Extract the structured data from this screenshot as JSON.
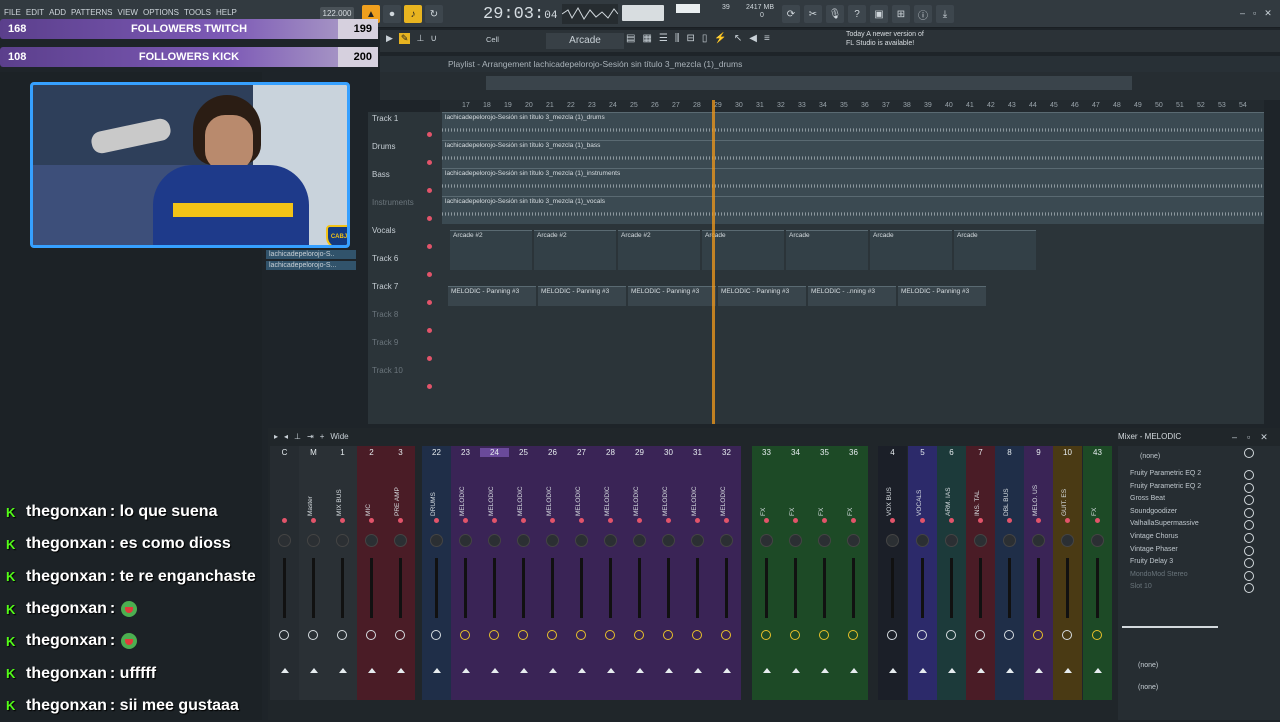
{
  "menu": [
    "FILE",
    "EDIT",
    "ADD",
    "PATTERNS",
    "VIEW",
    "OPTIONS",
    "TOOLS",
    "HELP"
  ],
  "transport": {
    "tempo": "122.000",
    "time_main": "29:03",
    "time_sub": "04",
    "cpu": "39",
    "ram": "2417 MB",
    "voices": "0"
  },
  "toolbar": {
    "snap": "Cell",
    "pattern": "Arcade"
  },
  "hint": {
    "line1": "Today  A newer version of",
    "line2": "FL Studio is available!"
  },
  "followers": [
    {
      "left": "168",
      "label": "FOLLOWERS TWITCH",
      "right": "199"
    },
    {
      "left": "108",
      "label": "FOLLOWERS KICK",
      "right": "200"
    }
  ],
  "browser": {
    "items": [
      "lachicadepelorojo-S..",
      "lachicadepelorojo-S..."
    ]
  },
  "playlist": {
    "title": "Playlist - Arrangement  lachicadepelorojo-Sesión sin título 3_mezcla (1)_drums",
    "ruler": [
      "17",
      "18",
      "19",
      "20",
      "21",
      "22",
      "23",
      "24",
      "25",
      "26",
      "27",
      "28",
      "29",
      "30",
      "31",
      "32",
      "33",
      "34",
      "35",
      "36",
      "37",
      "38",
      "39",
      "40",
      "41",
      "42",
      "43",
      "44",
      "45",
      "46",
      "47",
      "48",
      "49",
      "50",
      "51",
      "52",
      "53",
      "54"
    ],
    "tracks": [
      {
        "name": "Track 1",
        "clip": "lachicadepelorojo-Sesión sin título 3_mezcla (1)_drums",
        "dim": false
      },
      {
        "name": "Drums",
        "clip": "lachicadepelorojo-Sesión sin título 3_mezcla (1)_bass",
        "dim": false
      },
      {
        "name": "Bass",
        "clip": "lachicadepelorojo-Sesión sin título 3_mezcla (1)_instruments",
        "dim": false
      },
      {
        "name": "Instruments",
        "clip": "lachicadepelorojo-Sesión sin título 3_mezcla (1)_vocals",
        "dim": true
      },
      {
        "name": "Vocals",
        "clip": "Arcade #2",
        "dim": false
      },
      {
        "name": "Track 6",
        "clip": "",
        "dim": false
      },
      {
        "name": "Track 7",
        "clip": "MELODIC - Panning #3",
        "dim": false
      },
      {
        "name": "Track 8",
        "clip": "",
        "dim": true
      },
      {
        "name": "Track 9",
        "clip": "",
        "dim": true
      },
      {
        "name": "Track 10",
        "clip": "",
        "dim": true
      }
    ],
    "arcade_clips": [
      "Arcade #2",
      "Arcade #2",
      "Arcade #2",
      "Arcade",
      "Arcade",
      "Arcade",
      "Arcade"
    ],
    "panning_clips": [
      "MELODIC - Panning #3",
      "MELODIC - Panning #3",
      "MELODIC - Panning #3",
      "MELODIC - Panning #3",
      "MELODIC - ..nning #3",
      "MELODIC - Panning #3"
    ]
  },
  "mixer": {
    "title": "Mixer - MELODIC",
    "mode": "Wide",
    "strips": [
      {
        "n": "C",
        "lbl": "",
        "color": "#262c31"
      },
      {
        "n": "M",
        "lbl": "Master",
        "color": "#2a3035"
      },
      {
        "n": "1",
        "lbl": "MIX BUS",
        "color": "#2a3035"
      },
      {
        "n": "2",
        "lbl": "MIC",
        "color": "#4a1c26"
      },
      {
        "n": "3",
        "lbl": "PRE AMP",
        "color": "#4a1c26"
      },
      {
        "n": "22",
        "lbl": "DRUMS",
        "color": "#1f2e48"
      },
      {
        "n": "23",
        "lbl": "MELODIC",
        "color": "#3a2456"
      },
      {
        "n": "24",
        "lbl": "MELODIC",
        "color": "#3a2456"
      },
      {
        "n": "25",
        "lbl": "MELODIC",
        "color": "#3a2456"
      },
      {
        "n": "26",
        "lbl": "MELODIC",
        "color": "#3a2456"
      },
      {
        "n": "27",
        "lbl": "MELODIC",
        "color": "#3a2456"
      },
      {
        "n": "28",
        "lbl": "MELODIC",
        "color": "#3a2456"
      },
      {
        "n": "29",
        "lbl": "MELODIC",
        "color": "#3a2456"
      },
      {
        "n": "30",
        "lbl": "MELODIC",
        "color": "#3a2456"
      },
      {
        "n": "31",
        "lbl": "MELODIC",
        "color": "#3a2456"
      },
      {
        "n": "32",
        "lbl": "MELODIC",
        "color": "#3a2456"
      },
      {
        "n": "33",
        "lbl": "FX",
        "color": "#1d4a26"
      },
      {
        "n": "34",
        "lbl": "FX",
        "color": "#1d4a26"
      },
      {
        "n": "35",
        "lbl": "FX",
        "color": "#1d4a26"
      },
      {
        "n": "36",
        "lbl": "FX",
        "color": "#1d4a26"
      },
      {
        "n": "4",
        "lbl": "VOX BUS",
        "color": "#1b1f28"
      },
      {
        "n": "5",
        "lbl": "VOCALS",
        "color": "#2c2a6a"
      },
      {
        "n": "6",
        "lbl": "ARM. IAS",
        "color": "#1c3a3a"
      },
      {
        "n": "7",
        "lbl": "INS. TAL",
        "color": "#4a1c26"
      },
      {
        "n": "8",
        "lbl": "DBL BUS",
        "color": "#1f2e48"
      },
      {
        "n": "9",
        "lbl": "MELO. US",
        "color": "#3a2456"
      },
      {
        "n": "10",
        "lbl": "GUIT. ES",
        "color": "#4a3a14"
      },
      {
        "n": "43",
        "lbl": "FX",
        "color": "#1d4a26"
      }
    ],
    "fx": [
      {
        "name": "(none)",
        "on": true
      },
      {
        "name": "Fruity Parametric EQ 2",
        "on": true
      },
      {
        "name": "Fruity Parametric EQ 2",
        "on": true
      },
      {
        "name": "Gross Beat",
        "on": true
      },
      {
        "name": "Soundgoodizer",
        "on": true
      },
      {
        "name": "ValhallaSupermassive",
        "on": true
      },
      {
        "name": "Vintage Chorus",
        "on": true
      },
      {
        "name": "Vintage Phaser",
        "on": true
      },
      {
        "name": "Fruity Delay 3",
        "on": true
      },
      {
        "name": "MondoMod Stereo",
        "on": false
      },
      {
        "name": "Slot 10",
        "on": false
      }
    ],
    "sends": [
      "(none)",
      "(none)"
    ]
  },
  "chat": [
    {
      "user": "thegonxan",
      "msg": ": lo que suena",
      "emoji": false
    },
    {
      "user": "thegonxan",
      "msg": ": es como dioss",
      "emoji": false
    },
    {
      "user": "thegonxan",
      "msg": ": te re enganchaste",
      "emoji": false
    },
    {
      "user": "thegonxan",
      "msg": ":",
      "emoji": true
    },
    {
      "user": "thegonxan",
      "msg": ":",
      "emoji": true
    },
    {
      "user": "thegonxan",
      "msg": ": ufffff",
      "emoji": false
    },
    {
      "user": "thegonxan",
      "msg": ": sii mee gustaaa",
      "emoji": false
    }
  ],
  "webcam": {
    "badge": "CABJ"
  }
}
